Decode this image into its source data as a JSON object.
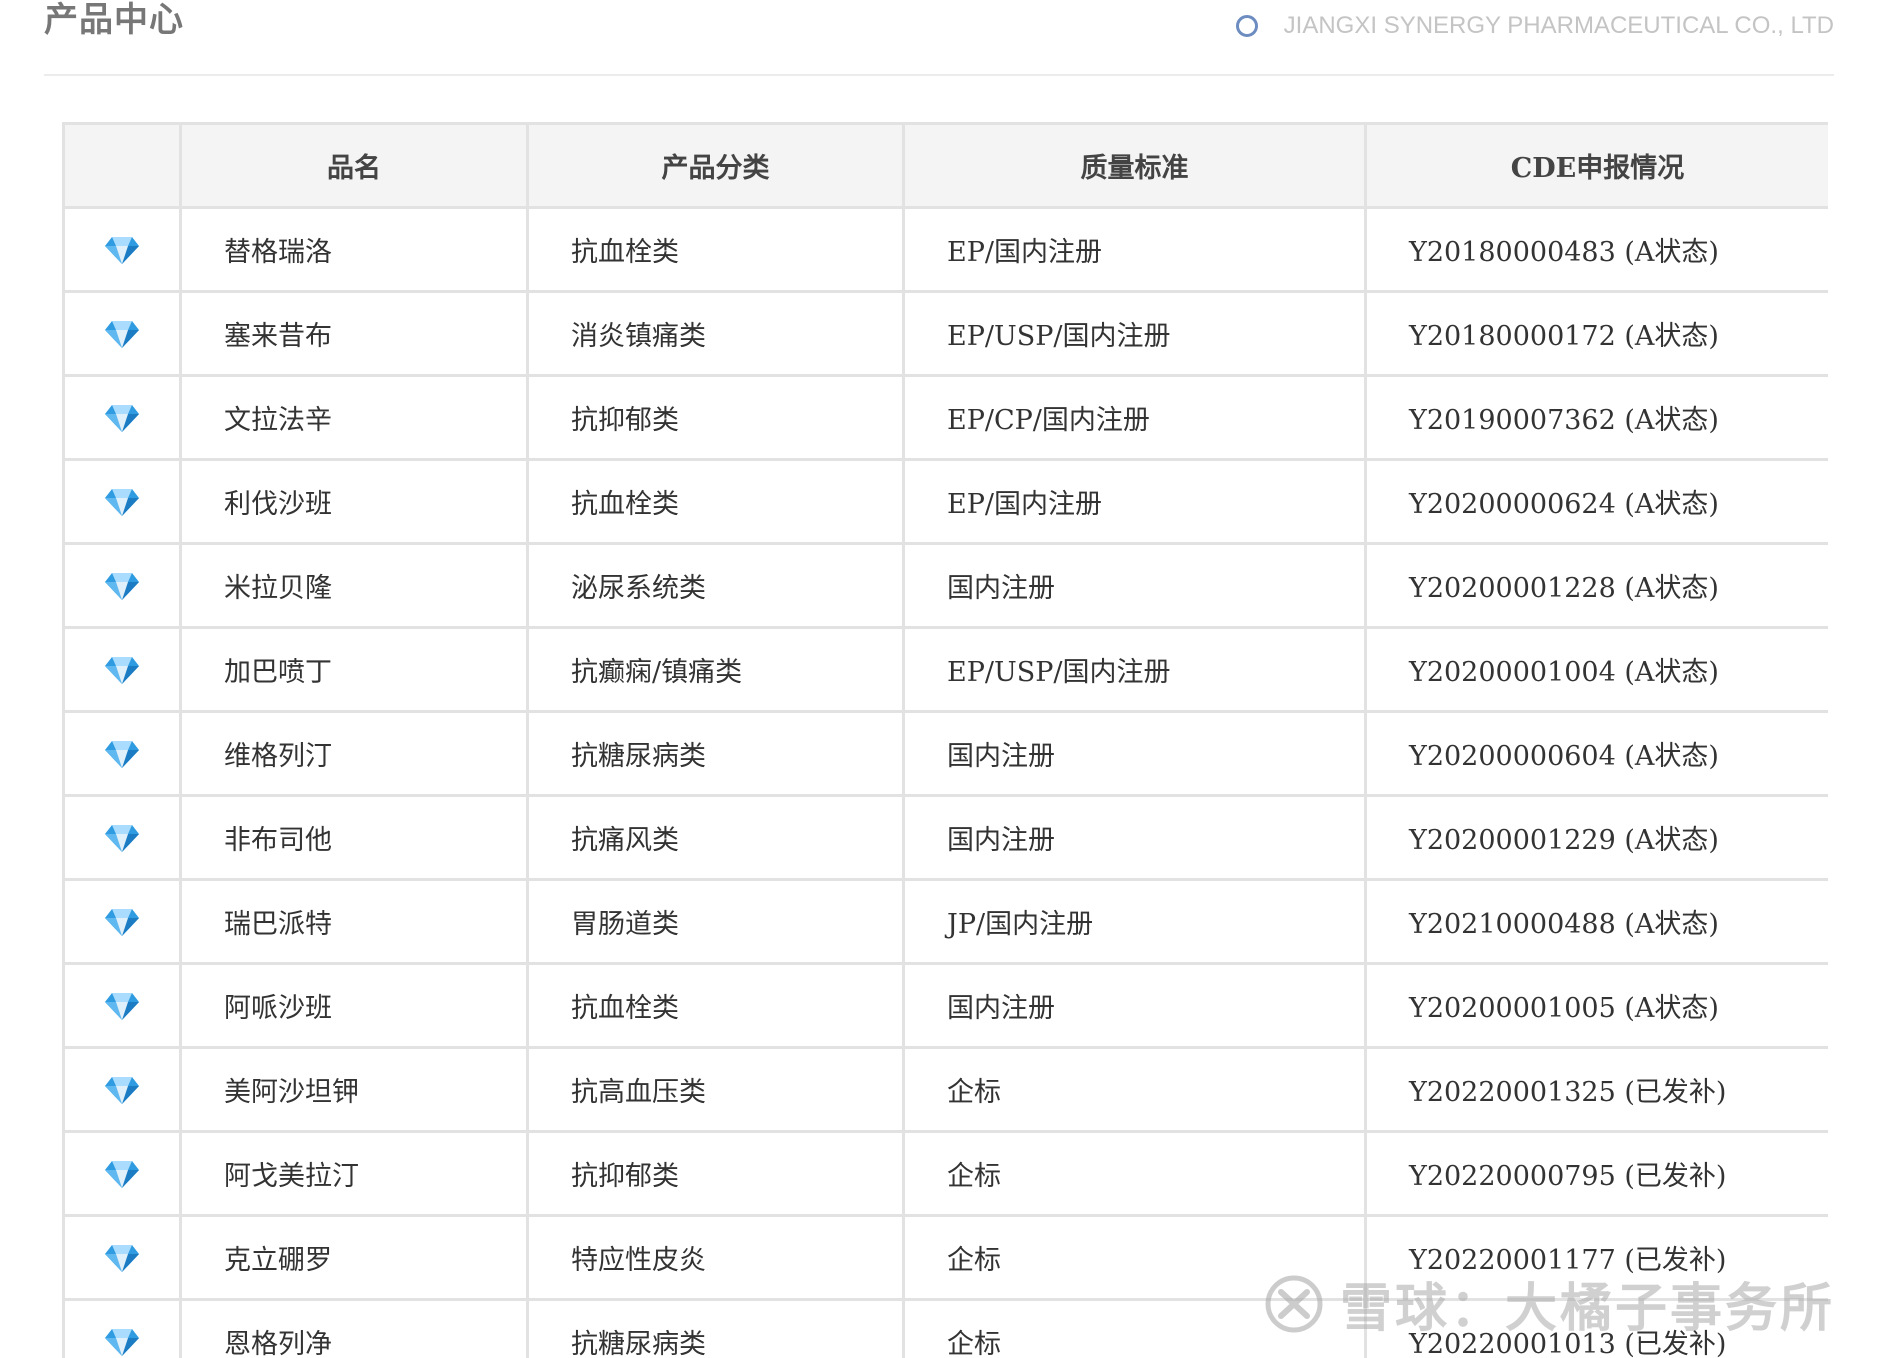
{
  "header": {
    "title": "产品中心",
    "company": "JIANGXI SYNERGY PHARMACEUTICAL CO., LTD"
  },
  "table": {
    "columns": [
      "",
      "品名",
      "产品分类",
      "质量标准",
      "CDE申报情况"
    ],
    "row_icon": "diamond-icon",
    "rows": [
      {
        "name": "替格瑞洛",
        "category": "抗血栓类",
        "standard": "EP/国内注册",
        "cde": "Y20180000483 (A状态)"
      },
      {
        "name": "塞来昔布",
        "category": "消炎镇痛类",
        "standard": "EP/USP/国内注册",
        "cde": "Y20180000172 (A状态)"
      },
      {
        "name": "文拉法辛",
        "category": "抗抑郁类",
        "standard": "EP/CP/国内注册",
        "cde": "Y20190007362 (A状态)"
      },
      {
        "name": "利伐沙班",
        "category": "抗血栓类",
        "standard": "EP/国内注册",
        "cde": "Y20200000624 (A状态)"
      },
      {
        "name": "米拉贝隆",
        "category": "泌尿系统类",
        "standard": "国内注册",
        "cde": "Y20200001228 (A状态)"
      },
      {
        "name": "加巴喷丁",
        "category": "抗癫痫/镇痛类",
        "standard": "EP/USP/国内注册",
        "cde": "Y20200001004 (A状态)"
      },
      {
        "name": "维格列汀",
        "category": "抗糖尿病类",
        "standard": "国内注册",
        "cde": "Y20200000604 (A状态)"
      },
      {
        "name": "非布司他",
        "category": "抗痛风类",
        "standard": "国内注册",
        "cde": "Y20200001229 (A状态)"
      },
      {
        "name": "瑞巴派特",
        "category": "胃肠道类",
        "standard": "JP/国内注册",
        "cde": "Y20210000488 (A状态)"
      },
      {
        "name": "阿哌沙班",
        "category": "抗血栓类",
        "standard": "国内注册",
        "cde": "Y20200001005 (A状态)"
      },
      {
        "name": "美阿沙坦钾",
        "category": "抗高血压类",
        "standard": "企标",
        "cde": "Y20220001325 (已发补)"
      },
      {
        "name": "阿戈美拉汀",
        "category": "抗抑郁类",
        "standard": "企标",
        "cde": "Y20220000795 (已发补)"
      },
      {
        "name": "克立硼罗",
        "category": "特应性皮炎",
        "standard": "企标",
        "cde": "Y20220001177 (已发补)"
      },
      {
        "name": "恩格列净",
        "category": "抗糖尿病类",
        "standard": "企标",
        "cde": "Y20220001013 (已发补)"
      }
    ]
  },
  "watermark": "雪球：大橘子事务所",
  "colors": {
    "gem": "#2f9be0",
    "border": "#e2e2e2",
    "header_bg": "#f4f4f4",
    "ring": "#6d8cc0"
  }
}
